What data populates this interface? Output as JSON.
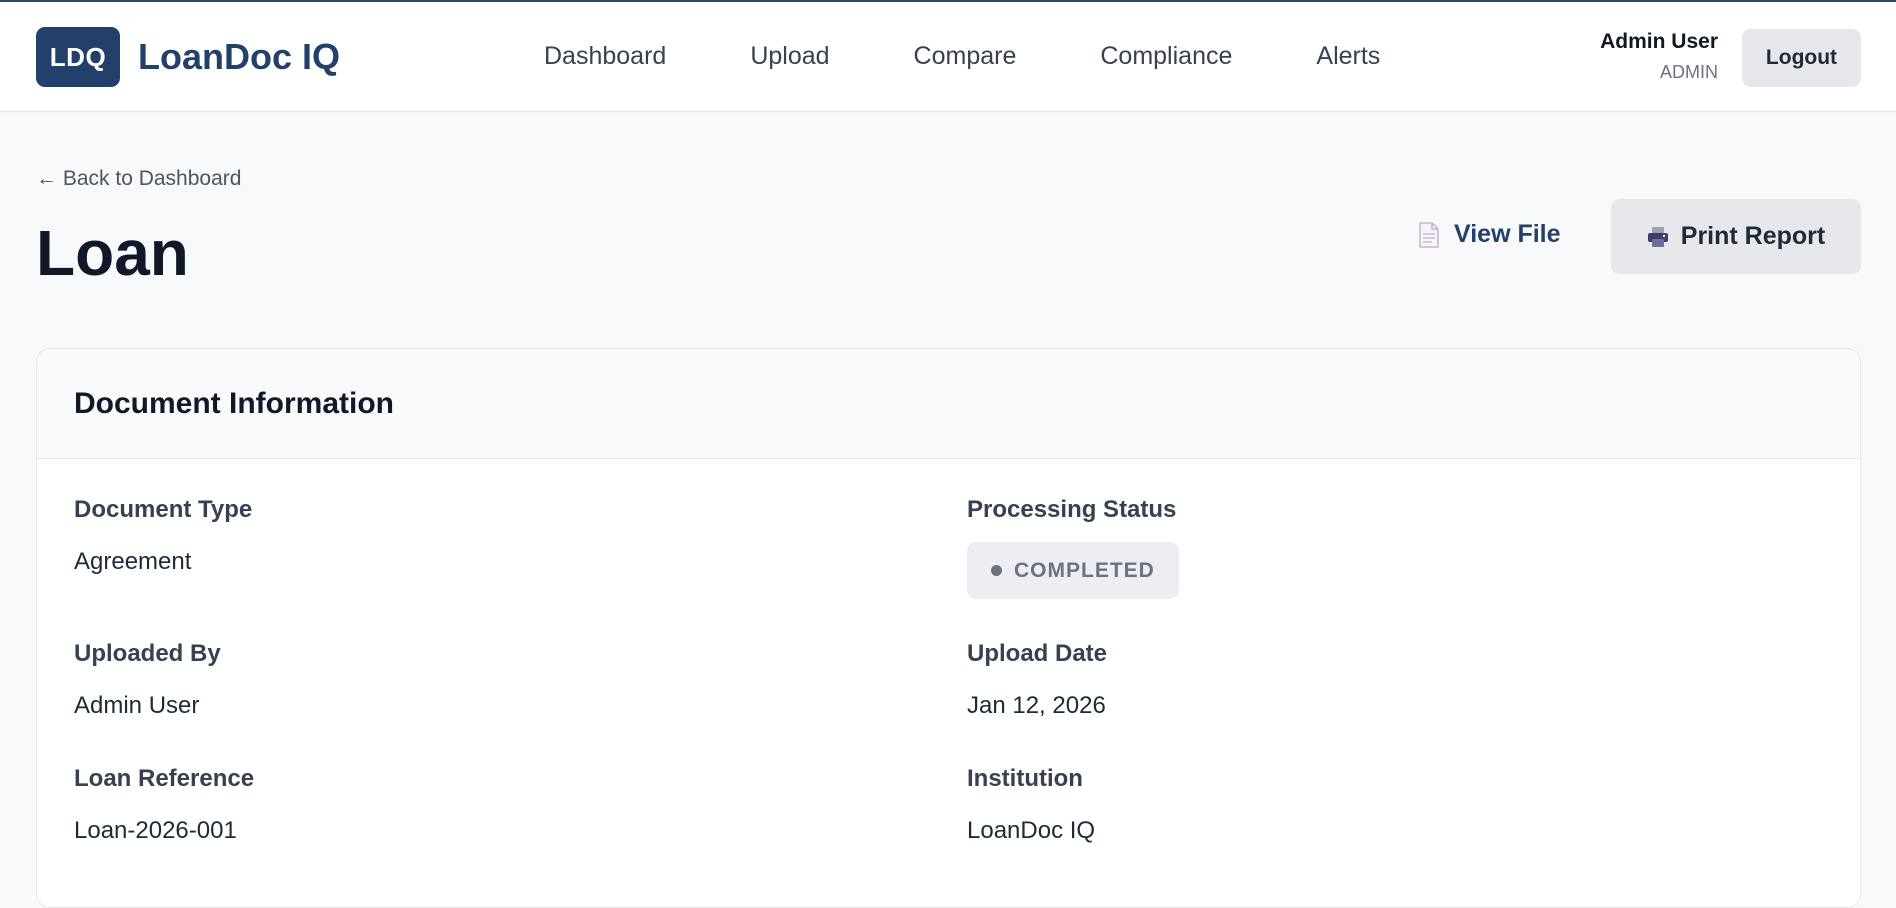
{
  "header": {
    "logo_mark": "LDQ",
    "app_name": "LoanDoc IQ",
    "nav": [
      "Dashboard",
      "Upload",
      "Compare",
      "Compliance",
      "Alerts"
    ],
    "user_name": "Admin User",
    "user_role": "ADMIN",
    "logout_label": "Logout"
  },
  "page": {
    "back_link": "← Back to Dashboard",
    "title": "Loan",
    "view_file_label": "View File",
    "print_label": "Print Report"
  },
  "doc_info": {
    "title": "Document Information",
    "document_type_label": "Document Type",
    "document_type_value": "Agreement",
    "status_label": "Processing Status",
    "status_value": "COMPLETED",
    "uploaded_by_label": "Uploaded By",
    "uploaded_by_value": "Admin User",
    "upload_date_label": "Upload Date",
    "upload_date_value": "Jan 12, 2026",
    "loan_reference_label": "Loan Reference",
    "loan_reference_value": "Loan-2026-001",
    "institution_label": "Institution",
    "institution_value": "LoanDoc IQ"
  },
  "icons": {
    "view_file": "document-icon",
    "print": "printer-icon",
    "status": "dot-icon"
  },
  "colors": {
    "brand": "#23406a",
    "status_neutral": "#6b7280"
  }
}
